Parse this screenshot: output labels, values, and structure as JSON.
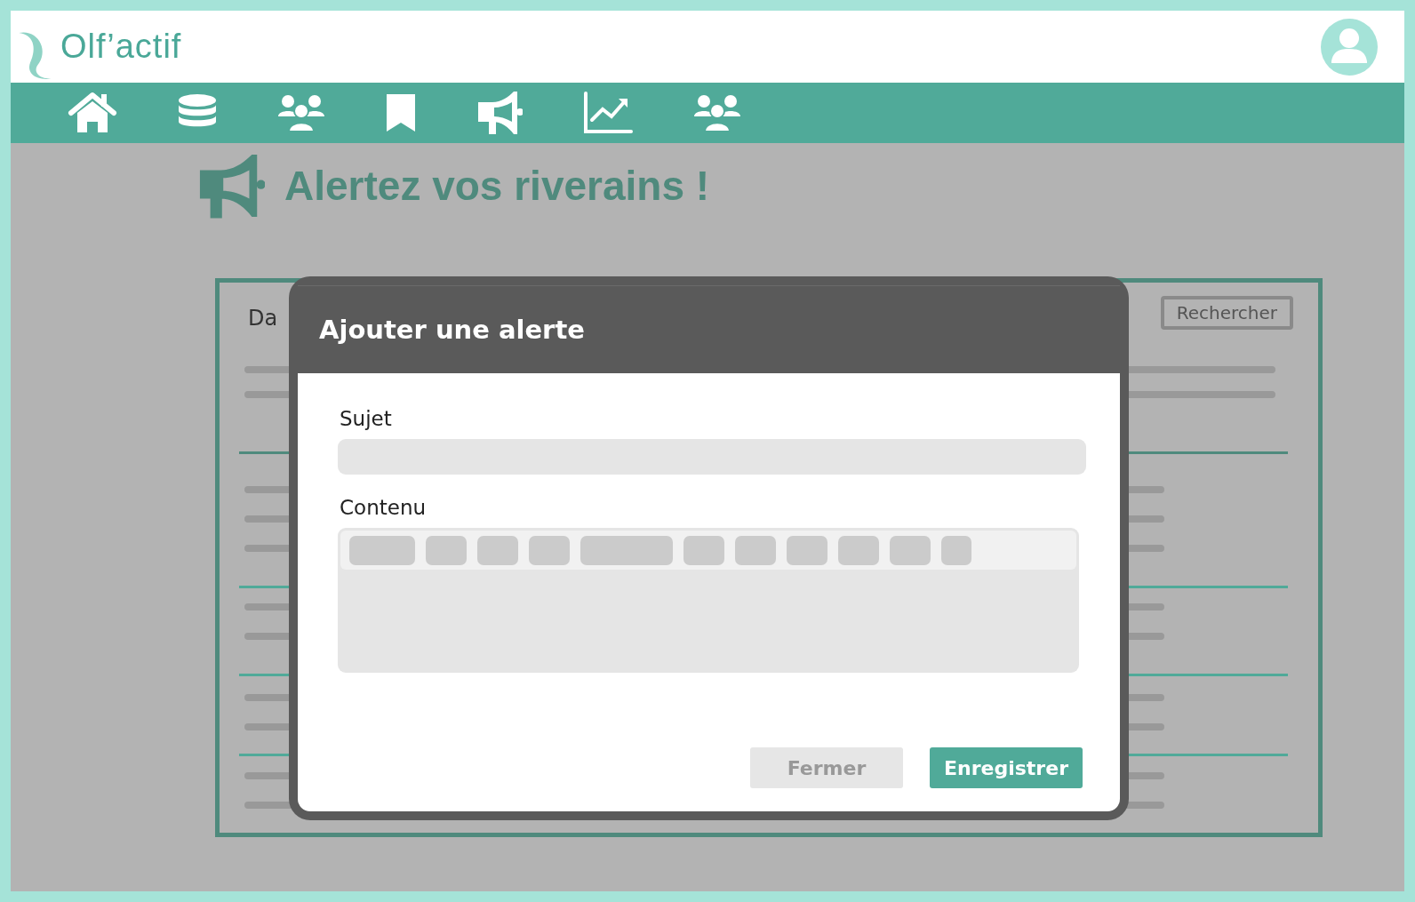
{
  "logo": {
    "text": "Olf’actif"
  },
  "page": {
    "title": "Alertez vos riverains !"
  },
  "background_card": {
    "label": "Da",
    "search_button": "Rechercher"
  },
  "modal": {
    "title": "Ajouter une alerte",
    "fields": [
      {
        "label": "Sujet",
        "kind": "text"
      },
      {
        "label": "Contenu",
        "kind": "rich"
      }
    ],
    "buttons": [
      {
        "label": "Fermer",
        "kind": "secondary"
      },
      {
        "label": "Enregistrer",
        "kind": "primary"
      }
    ]
  }
}
